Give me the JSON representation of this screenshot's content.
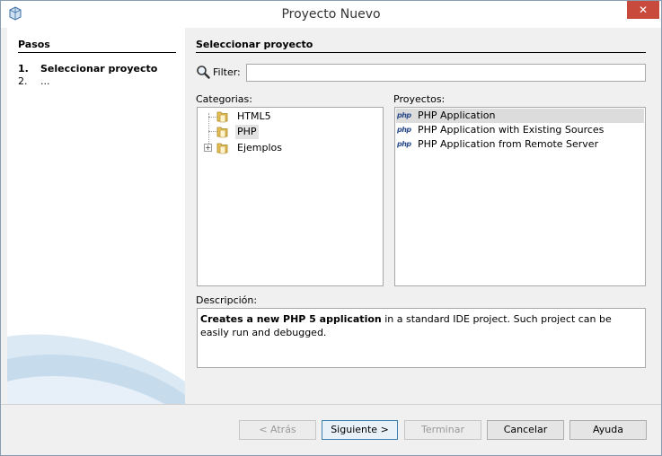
{
  "window": {
    "title": "Proyecto Nuevo",
    "close_label": "✕"
  },
  "steps": {
    "title": "Pasos",
    "items": [
      {
        "num": "1.",
        "label": "Seleccionar proyecto"
      },
      {
        "num": "2.",
        "label": "..."
      }
    ]
  },
  "main": {
    "section_title": "Seleccionar proyecto",
    "filter": {
      "label": "Filter:",
      "value": ""
    },
    "categories_label": "Categorias:",
    "projects_label": "Proyectos:",
    "categories": [
      {
        "label": "HTML5"
      },
      {
        "label": "PHP"
      },
      {
        "label": "Ejemplos"
      }
    ],
    "projects": [
      {
        "icon_text": "php",
        "label": "PHP Application"
      },
      {
        "icon_text": "php",
        "label": "PHP Application with Existing Sources"
      },
      {
        "icon_text": "php",
        "label": "PHP Application from Remote Server"
      }
    ],
    "description_label": "Descripción:",
    "description": {
      "bold": "Creates a new PHP 5 application",
      "rest": " in a standard IDE project. Such project can be easily run and debugged."
    }
  },
  "buttons": {
    "back": "< Atrás",
    "next": "Siguiente >",
    "finish": "Terminar",
    "cancel": "Cancelar",
    "help": "Ayuda"
  },
  "colors": {
    "close_button": "#c74a3c",
    "selection": "#dcdcdc",
    "folder": "#e8c15a"
  }
}
